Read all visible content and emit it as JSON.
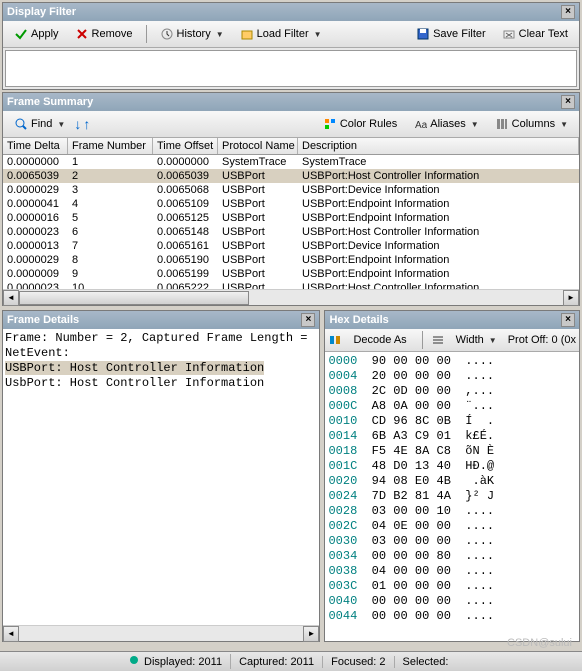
{
  "displayFilter": {
    "title": "Display Filter",
    "apply": "Apply",
    "remove": "Remove",
    "history": "History",
    "loadFilter": "Load Filter",
    "saveFilter": "Save Filter",
    "clearText": "Clear Text"
  },
  "frameSummary": {
    "title": "Frame Summary",
    "find": "Find",
    "colorRules": "Color Rules",
    "aliases": "Aliases",
    "columns": "Columns",
    "headers": {
      "timeDelta": "Time Delta",
      "frameNumber": "Frame Number",
      "timeOffset": "Time Offset",
      "protocolName": "Protocol Name",
      "description": "Description"
    },
    "rows": [
      {
        "td": "0.0000000",
        "fn": "1",
        "to": "0.0000000",
        "pn": "SystemTrace",
        "de": "SystemTrace",
        "sel": false
      },
      {
        "td": "0.0065039",
        "fn": "2",
        "to": "0.0065039",
        "pn": "USBPort",
        "de": "USBPort:Host Controller Information",
        "sel": true
      },
      {
        "td": "0.0000029",
        "fn": "3",
        "to": "0.0065068",
        "pn": "USBPort",
        "de": "USBPort:Device Information",
        "sel": false
      },
      {
        "td": "0.0000041",
        "fn": "4",
        "to": "0.0065109",
        "pn": "USBPort",
        "de": "USBPort:Endpoint Information",
        "sel": false
      },
      {
        "td": "0.0000016",
        "fn": "5",
        "to": "0.0065125",
        "pn": "USBPort",
        "de": "USBPort:Endpoint Information",
        "sel": false
      },
      {
        "td": "0.0000023",
        "fn": "6",
        "to": "0.0065148",
        "pn": "USBPort",
        "de": "USBPort:Host Controller Information",
        "sel": false
      },
      {
        "td": "0.0000013",
        "fn": "7",
        "to": "0.0065161",
        "pn": "USBPort",
        "de": "USBPort:Device Information",
        "sel": false
      },
      {
        "td": "0.0000029",
        "fn": "8",
        "to": "0.0065190",
        "pn": "USBPort",
        "de": "USBPort:Endpoint Information",
        "sel": false
      },
      {
        "td": "0.0000009",
        "fn": "9",
        "to": "0.0065199",
        "pn": "USBPort",
        "de": "USBPort:Endpoint Information",
        "sel": false
      },
      {
        "td": "0.0000023",
        "fn": "10",
        "to": "0.0065222",
        "pn": "USBPort",
        "de": "USBPort:Host Controller Information",
        "sel": false
      }
    ]
  },
  "frameDetails": {
    "title": "Frame Details",
    "line1": "Frame: Number = 2, Captured Frame Length =",
    "line2": "NetEvent:",
    "line3": "USBPort: Host Controller Information",
    "line4": "UsbPort: Host Controller Information"
  },
  "hexDetails": {
    "title": "Hex Details",
    "decodeAs": "Decode As",
    "width": "Width",
    "protOff": "Prot Off: 0 (0x",
    "rows": [
      {
        "off": "0000",
        "b": "90 00 00 00",
        "a": "...."
      },
      {
        "off": "0004",
        "b": "20 00 00 00",
        "a": "...."
      },
      {
        "off": "0008",
        "b": "2C 0D 00 00",
        "a": ",..."
      },
      {
        "off": "000C",
        "b": "A8 0A 00 00",
        "a": "¨..."
      },
      {
        "off": "0010",
        "b": "CD 96 8C 0B",
        "a": "Í  ."
      },
      {
        "off": "0014",
        "b": "6B A3 C9 01",
        "a": "k£É."
      },
      {
        "off": "0018",
        "b": "F5 4E 8A C8",
        "a": "õN È"
      },
      {
        "off": "001C",
        "b": "48 D0 13 40",
        "a": "HÐ.@"
      },
      {
        "off": "0020",
        "b": "94 08 E0 4B",
        "a": " .àK"
      },
      {
        "off": "0024",
        "b": "7D B2 81 4A",
        "a": "}² J"
      },
      {
        "off": "0028",
        "b": "03 00 00 10",
        "a": "...."
      },
      {
        "off": "002C",
        "b": "04 0E 00 00",
        "a": "...."
      },
      {
        "off": "0030",
        "b": "03 00 00 00",
        "a": "...."
      },
      {
        "off": "0034",
        "b": "00 00 00 80",
        "a": "...."
      },
      {
        "off": "0038",
        "b": "04 00 00 00",
        "a": "...."
      },
      {
        "off": "003C",
        "b": "01 00 00 00",
        "a": "...."
      },
      {
        "off": "0040",
        "b": "00 00 00 00",
        "a": "...."
      },
      {
        "off": "0044",
        "b": "00 00 00 00",
        "a": "...."
      }
    ]
  },
  "status": {
    "displayed": "Displayed: 2011",
    "captured": "Captured: 2011",
    "focused": "Focused: 2",
    "selected": "Selected:"
  },
  "watermark": "CSDN@sului"
}
